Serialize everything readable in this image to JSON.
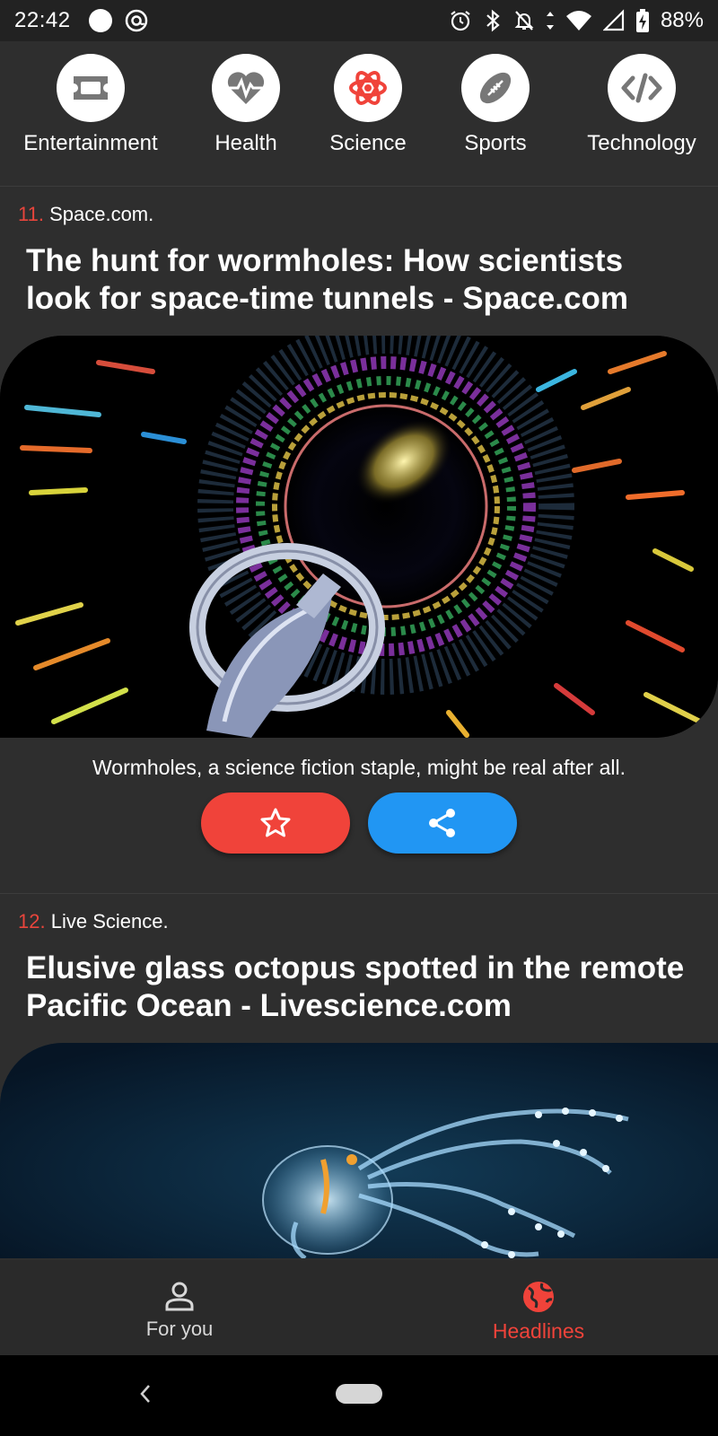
{
  "status_bar": {
    "time": "22:42",
    "battery": "88%",
    "icons": [
      "circle-icon",
      "at-icon",
      "alarm-icon",
      "bluetooth-icon",
      "bell-off-icon",
      "data-arrows-icon",
      "wifi-icon",
      "signal-icon",
      "battery-charging-icon"
    ]
  },
  "categories": [
    {
      "label": "Entertainment",
      "icon": "ticket-icon"
    },
    {
      "label": "Health",
      "icon": "heartbeat-icon"
    },
    {
      "label": "Science",
      "icon": "atom-icon"
    },
    {
      "label": "Sports",
      "icon": "football-icon"
    },
    {
      "label": "Technology",
      "icon": "code-icon"
    }
  ],
  "articles": [
    {
      "number": "11.",
      "source": "Space.com.",
      "headline": "The hunt for wormholes: How scientists look for space-time tunnels - Space.com",
      "caption": "Wormholes, a science fiction staple, might be real after all.",
      "image": "wormhole-spaceship-image"
    },
    {
      "number": "12.",
      "source": "Live Science.",
      "headline": "Elusive glass octopus spotted in the remote Pacific Ocean - Livescience.com",
      "image": "glass-octopus-image"
    }
  ],
  "bottom_nav": {
    "for_you": "For you",
    "headlines": "Headlines",
    "active": "headlines"
  },
  "colors": {
    "accent_red": "#f0433a",
    "share_blue": "#2196f3",
    "background": "#2e2e2e"
  }
}
